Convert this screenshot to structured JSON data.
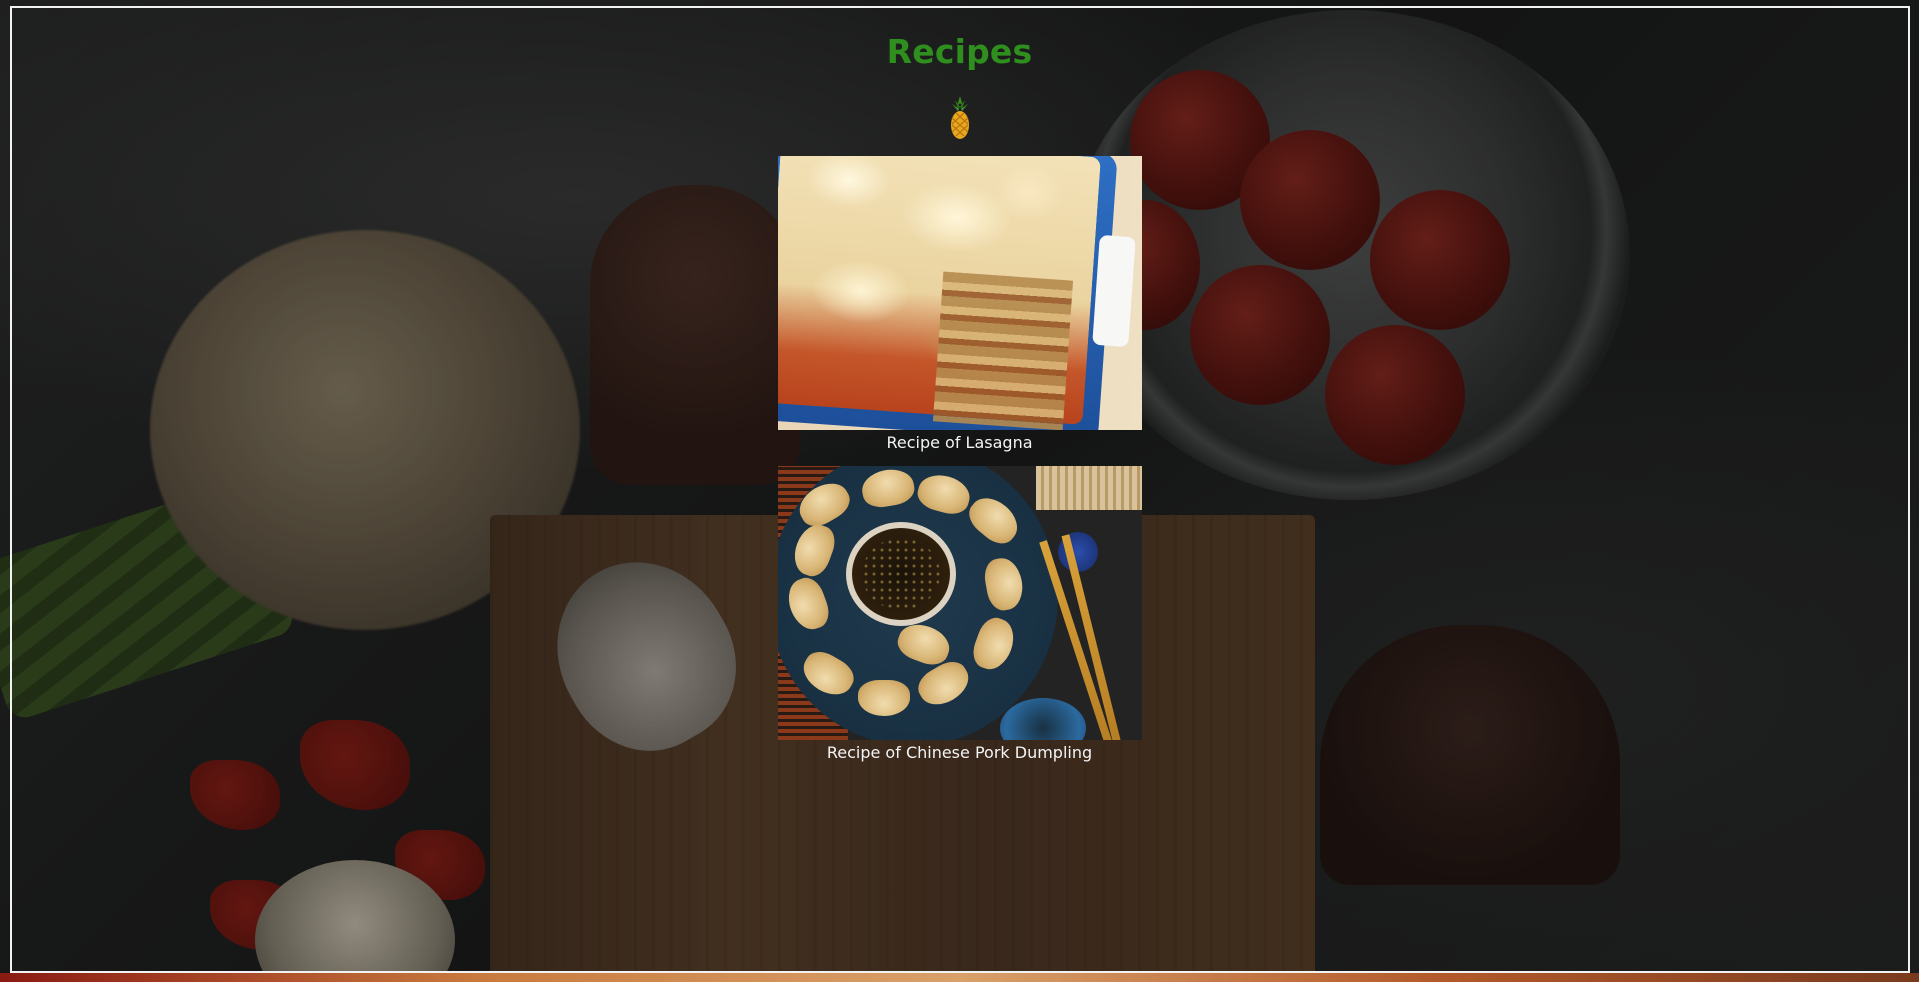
{
  "page": {
    "title": "Recipes",
    "title_color": "#2f8f1e",
    "logo_icon": "pineapple-icon"
  },
  "recipes": [
    {
      "caption": "Recipe of Lasagna",
      "image": "lasagna-photo"
    },
    {
      "caption": "Recipe of Chinese Pork Dumpling",
      "image": "dumpling-photo"
    }
  ],
  "colors": {
    "frame_border": "#f2f2f2",
    "caption_text": "#f4f4f4"
  }
}
